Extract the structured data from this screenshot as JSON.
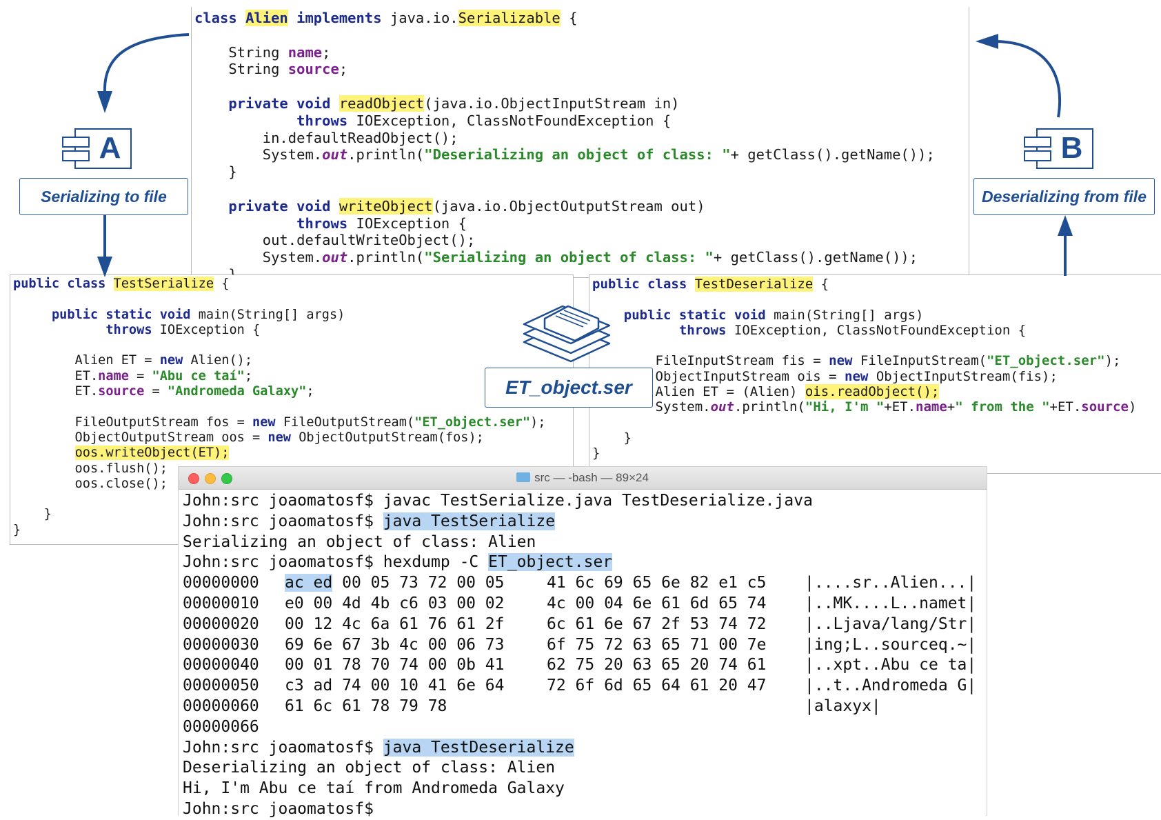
{
  "labels": {
    "component_a": "A",
    "component_b": "B",
    "serializing": "Serializing to file",
    "deserializing": "Deserializing from file",
    "file": "ET_object.ser"
  },
  "alien_code": [
    [
      {
        "t": "class ",
        "c": "kw"
      },
      {
        "t": "Alien",
        "c": "hlkw"
      },
      {
        "t": " implements ",
        "c": "kw"
      },
      {
        "t": "java.io."
      },
      {
        "t": "Serializable",
        "c": "hl"
      },
      {
        "t": " {"
      }
    ],
    [],
    [
      {
        "t": "    String "
      },
      {
        "t": "name",
        "c": "fld"
      },
      {
        "t": ";"
      }
    ],
    [
      {
        "t": "    String "
      },
      {
        "t": "source",
        "c": "fld"
      },
      {
        "t": ";"
      }
    ],
    [],
    [
      {
        "t": "    "
      },
      {
        "t": "private void ",
        "c": "kw"
      },
      {
        "t": "readObject",
        "c": "hl"
      },
      {
        "t": "(java.io.ObjectInputStream in)"
      }
    ],
    [
      {
        "t": "            "
      },
      {
        "t": "throws ",
        "c": "kw"
      },
      {
        "t": "IOException, ClassNotFoundException {"
      }
    ],
    [
      {
        "t": "        in.defaultReadObject();"
      }
    ],
    [
      {
        "t": "        System."
      },
      {
        "t": "out",
        "c": "sf"
      },
      {
        "t": ".println("
      },
      {
        "t": "\"Deserializing an object of class: \"",
        "c": "st"
      },
      {
        "t": "+ getClass().getName());"
      }
    ],
    [
      {
        "t": "    }"
      }
    ],
    [],
    [
      {
        "t": "    "
      },
      {
        "t": "private void ",
        "c": "kw"
      },
      {
        "t": "writeObject",
        "c": "hl"
      },
      {
        "t": "(java.io.ObjectOutputStream out)"
      }
    ],
    [
      {
        "t": "            "
      },
      {
        "t": "throws ",
        "c": "kw"
      },
      {
        "t": "IOException {"
      }
    ],
    [
      {
        "t": "        out.defaultWriteObject();"
      }
    ],
    [
      {
        "t": "        System."
      },
      {
        "t": "out",
        "c": "sf"
      },
      {
        "t": ".println("
      },
      {
        "t": "\"Serializing an object of class: \"",
        "c": "st"
      },
      {
        "t": "+ getClass().getName());"
      }
    ],
    [
      {
        "t": "    }"
      }
    ]
  ],
  "serialize_code": [
    [
      {
        "t": "public class ",
        "c": "kw"
      },
      {
        "t": "TestSerialize",
        "c": "hl"
      },
      {
        "t": " {"
      }
    ],
    [],
    [
      {
        "t": "     "
      },
      {
        "t": "public static void ",
        "c": "kw"
      },
      {
        "t": "main(String[] args)"
      }
    ],
    [
      {
        "t": "            "
      },
      {
        "t": "throws ",
        "c": "kw"
      },
      {
        "t": "IOException {"
      }
    ],
    [],
    [
      {
        "t": "        Alien ET = "
      },
      {
        "t": "new ",
        "c": "kw"
      },
      {
        "t": "Alien();"
      }
    ],
    [
      {
        "t": "        ET."
      },
      {
        "t": "name",
        "c": "fld"
      },
      {
        "t": " = "
      },
      {
        "t": "\"Abu ce taí\"",
        "c": "st"
      },
      {
        "t": ";"
      }
    ],
    [
      {
        "t": "        ET."
      },
      {
        "t": "source",
        "c": "fld"
      },
      {
        "t": " = "
      },
      {
        "t": "\"Andromeda Galaxy\"",
        "c": "st"
      },
      {
        "t": ";"
      }
    ],
    [],
    [
      {
        "t": "        FileOutputStream fos = "
      },
      {
        "t": "new ",
        "c": "kw"
      },
      {
        "t": "FileOutputStream("
      },
      {
        "t": "\"ET_object.ser\"",
        "c": "st"
      },
      {
        "t": ");"
      }
    ],
    [
      {
        "t": "        ObjectOutputStream oos = "
      },
      {
        "t": "new ",
        "c": "kw"
      },
      {
        "t": "ObjectOutputStream(fos);"
      }
    ],
    [
      {
        "t": "        "
      },
      {
        "t": "oos.writeObject(ET);",
        "c": "hl"
      }
    ],
    [
      {
        "t": "        oos.flush();"
      }
    ],
    [
      {
        "t": "        oos.close();"
      }
    ],
    [],
    [
      {
        "t": "    }"
      }
    ],
    [
      {
        "t": "}"
      }
    ]
  ],
  "deserialize_code": [
    [
      {
        "t": "public class ",
        "c": "kw"
      },
      {
        "t": "TestDeserialize",
        "c": "hl"
      },
      {
        "t": " {"
      }
    ],
    [],
    [
      {
        "t": "    "
      },
      {
        "t": "public static void ",
        "c": "kw"
      },
      {
        "t": "main(String[] args)"
      }
    ],
    [
      {
        "t": "           "
      },
      {
        "t": "throws ",
        "c": "kw"
      },
      {
        "t": "IOException, ClassNotFoundException {"
      }
    ],
    [],
    [
      {
        "t": "        FileInputStream fis = "
      },
      {
        "t": "new ",
        "c": "kw"
      },
      {
        "t": "FileInputStream("
      },
      {
        "t": "\"ET_object.ser\"",
        "c": "st"
      },
      {
        "t": ");"
      }
    ],
    [
      {
        "t": "        ObjectInputStream ois = "
      },
      {
        "t": "new ",
        "c": "kw"
      },
      {
        "t": "ObjectInputStream(fis);"
      }
    ],
    [
      {
        "t": "        Alien ET = (Alien) "
      },
      {
        "t": "ois.readObject();",
        "c": "hl"
      }
    ],
    [
      {
        "t": "        System."
      },
      {
        "t": "out",
        "c": "sf"
      },
      {
        "t": ".println("
      },
      {
        "t": "\"Hi, I'm \"",
        "c": "st"
      },
      {
        "t": "+ET."
      },
      {
        "t": "name",
        "c": "fld"
      },
      {
        "t": "+"
      },
      {
        "t": "\" from the \"",
        "c": "st"
      },
      {
        "t": "+ET."
      },
      {
        "t": "source",
        "c": "fld"
      },
      {
        "t": ")"
      }
    ],
    [],
    [
      {
        "t": "    }"
      }
    ],
    [
      {
        "t": "}"
      }
    ]
  ],
  "terminal": {
    "title": "src — -bash — 89×24",
    "prompt": "John:src joaomatosf$ ",
    "cmd1": "javac TestSerialize.java TestDeserialize.java",
    "cmd2": "java TestSerialize",
    "out2": "Serializing an object of class: Alien",
    "cmd3": "hexdump -C ",
    "cmd3_file": "ET_object.ser",
    "hexdump": [
      {
        "offset": "00000000",
        "first": "ac ed",
        "a": " 00 05 73 72 00 05",
        "b": "41 6c 69 65 6e 82 e1 c5",
        "ascii": "|....sr..Alien...|"
      },
      {
        "offset": "00000010",
        "first": "",
        "a": "e0 00 4d 4b c6 03 00 02",
        "b": "4c 00 04 6e 61 6d 65 74",
        "ascii": "|..MK....L..namet|"
      },
      {
        "offset": "00000020",
        "first": "",
        "a": "00 12 4c 6a 61 76 61 2f",
        "b": "6c 61 6e 67 2f 53 74 72",
        "ascii": "|..Ljava/lang/Str|"
      },
      {
        "offset": "00000030",
        "first": "",
        "a": "69 6e 67 3b 4c 00 06 73",
        "b": "6f 75 72 63 65 71 00 7e",
        "ascii": "|ing;L..sourceq.~|"
      },
      {
        "offset": "00000040",
        "first": "",
        "a": "00 01 78 70 74 00 0b 41",
        "b": "62 75 20 63 65 20 74 61",
        "ascii": "|..xpt..Abu ce ta|"
      },
      {
        "offset": "00000050",
        "first": "",
        "a": "c3 ad 74 00 10 41 6e 64",
        "b": "72 6f 6d 65 64 61 20 47",
        "ascii": "|..t..Andromeda G|"
      },
      {
        "offset": "00000060",
        "first": "",
        "a": "61 6c 61 78 79 78",
        "b": "",
        "ascii": "|alaxyx|"
      },
      {
        "offset": "00000066",
        "first": "",
        "a": "",
        "b": "",
        "ascii": ""
      }
    ],
    "cmd4": "java TestDeserialize",
    "out4a": "Deserializing an object of class: Alien",
    "out4b": "Hi, I'm Abu ce taí from Andromeda Galaxy"
  },
  "colors": {
    "accent": "#1f4f92",
    "keyword": "#1c2a8e",
    "string": "#2a8a2a",
    "field": "#7a1f8c",
    "highlight": "#fff37a",
    "selection": "#b8d6f3"
  }
}
